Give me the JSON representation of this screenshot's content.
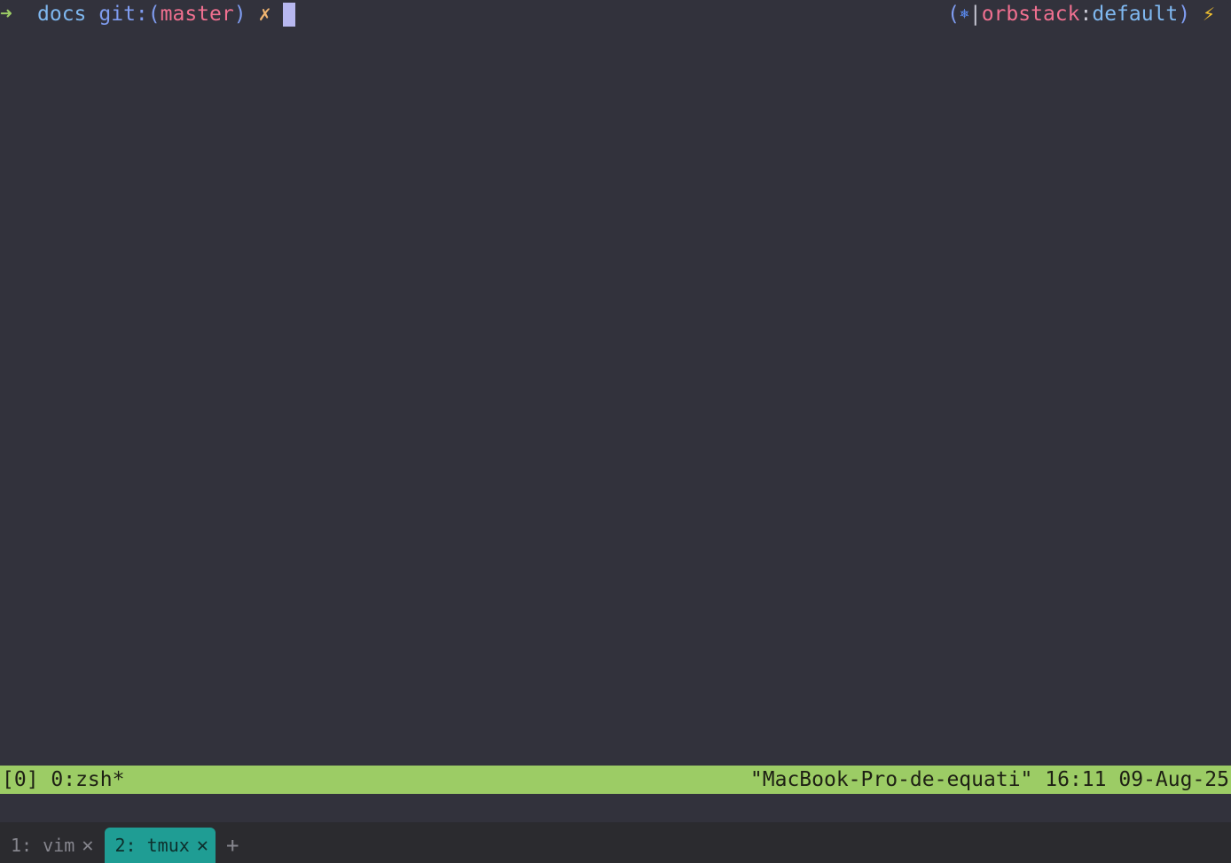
{
  "prompt": {
    "arrow": "➜",
    "directory": "docs",
    "git_label": "git:",
    "git_open": "(",
    "git_branch": "master",
    "git_close": ")",
    "dirty_mark": "✗",
    "k8s_open": "(",
    "k8s_icon": "⎈",
    "k8s_sep": "|",
    "k8s_context": "orbstack",
    "k8s_colon": ":",
    "k8s_namespace": "default",
    "k8s_close": ")",
    "bolt": "⚡"
  },
  "status_bar": {
    "session": "[0] 0:zsh*",
    "host": "\"MacBook-Pro-de-equati\"",
    "time": "16:11",
    "date": "09-Aug-25"
  },
  "tabs": [
    {
      "label": "1: vim",
      "close": "✕",
      "active": false
    },
    {
      "label": "2: tmux",
      "close": "✕",
      "active": true
    }
  ],
  "new_tab": "+",
  "colors": {
    "background": "#32323c",
    "arrow": "#9ccc65",
    "directory": "#7fb8f0",
    "git_label": "#7f9cf0",
    "branch": "#f07090",
    "dirty": "#f0b470",
    "k8s_icon": "#5a8af0",
    "status_bg": "#9ccc65",
    "active_tab": "#1f9d94"
  }
}
